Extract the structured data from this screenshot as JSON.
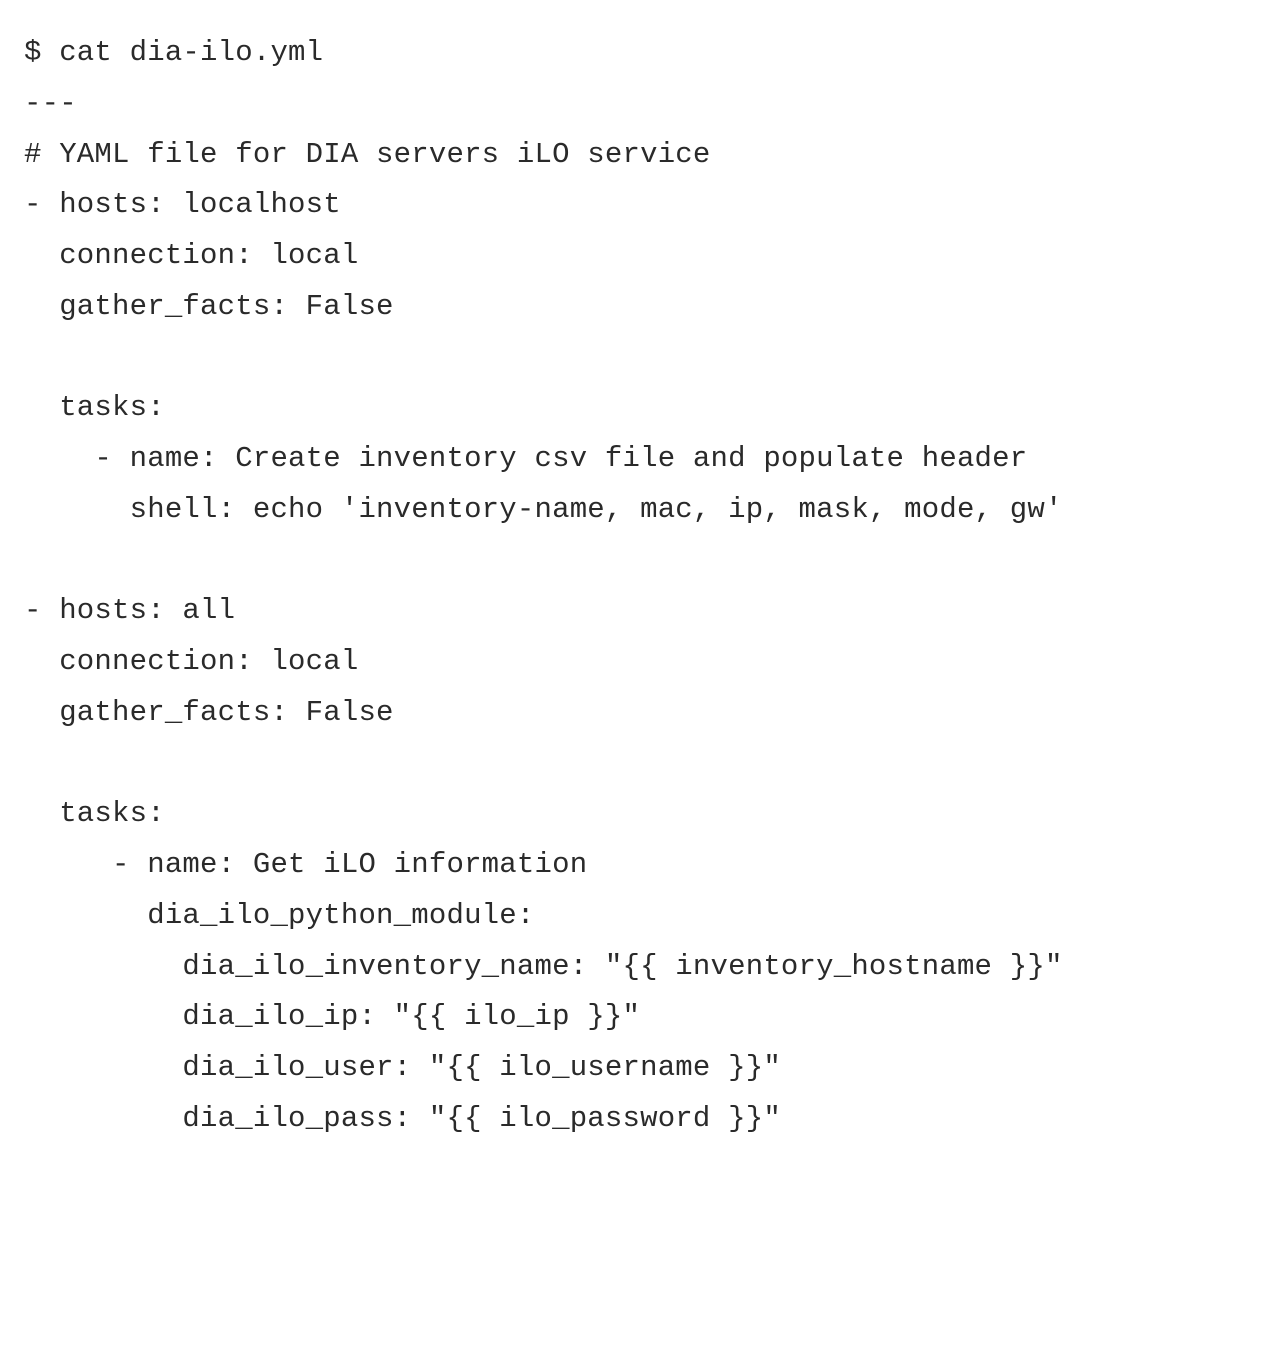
{
  "code": {
    "lines": [
      "$ cat dia-ilo.yml",
      "---",
      "# YAML file for DIA servers iLO service",
      "- hosts: localhost",
      "  connection: local",
      "  gather_facts: False",
      "",
      "  tasks:",
      "    - name: Create inventory csv file and populate header",
      "      shell: echo 'inventory-name, mac, ip, mask, mode, gw'",
      "",
      "- hosts: all",
      "  connection: local",
      "  gather_facts: False",
      "",
      "  tasks:",
      "     - name: Get iLO information",
      "       dia_ilo_python_module:",
      "         dia_ilo_inventory_name: \"{{ inventory_hostname }}\"",
      "         dia_ilo_ip: \"{{ ilo_ip }}\"",
      "         dia_ilo_user: \"{{ ilo_username }}\"",
      "         dia_ilo_pass: \"{{ ilo_password }}\""
    ]
  }
}
